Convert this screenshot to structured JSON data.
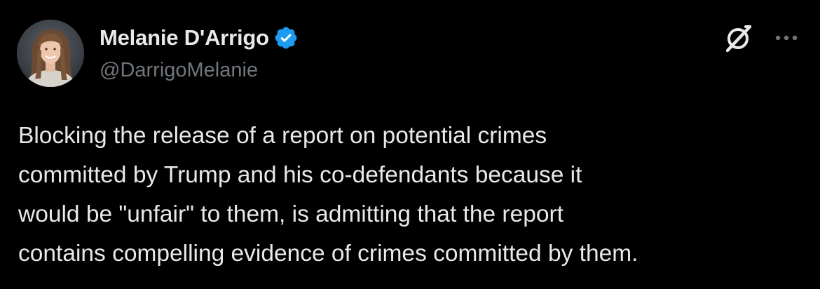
{
  "author": {
    "display_name": "Melanie D'Arrigo",
    "handle": "@DarrigoMelanie",
    "verified": true
  },
  "icons": {
    "avatar": "profile-photo",
    "verified": "verified-badge-icon",
    "grok": "grok-icon",
    "more": "more-options-icon"
  },
  "tweet": {
    "lines": [
      "Blocking the release of a report on potential crimes",
      "committed by Trump and his co-defendants because it",
      "would be \"unfair\" to them, is admitting that the report",
      "contains compelling evidence of crimes committed by them."
    ]
  },
  "colors": {
    "background": "#000000",
    "text": "#e7e9ea",
    "secondary_text": "#71767b",
    "verified_blue": "#1d9bf0"
  }
}
